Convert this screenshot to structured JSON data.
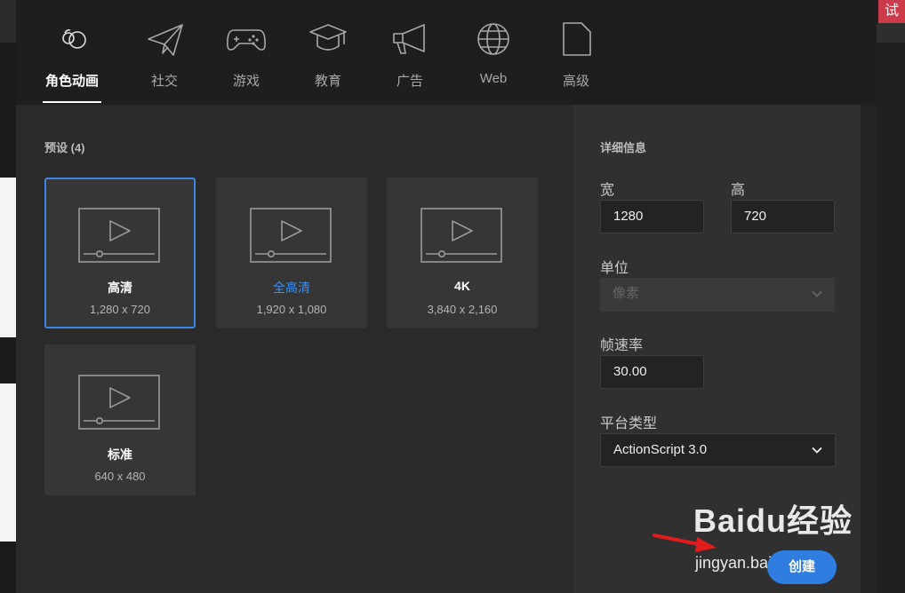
{
  "corner_badge": "试",
  "tabs": [
    {
      "label": "角色动画",
      "icon": "character-animation-icon",
      "active": true
    },
    {
      "label": "社交",
      "icon": "paper-plane-icon"
    },
    {
      "label": "游戏",
      "icon": "gamepad-icon"
    },
    {
      "label": "教育",
      "icon": "graduation-cap-icon"
    },
    {
      "label": "广告",
      "icon": "megaphone-icon"
    },
    {
      "label": "Web",
      "icon": "globe-icon"
    },
    {
      "label": "高级",
      "icon": "document-icon"
    }
  ],
  "presets": {
    "title": "预设 (4)",
    "items": [
      {
        "name": "高清",
        "size": "1,280 x 720",
        "selected": true
      },
      {
        "name": "全高清",
        "size": "1,920 x 1,080"
      },
      {
        "name": "4K",
        "size": "3,840 x 2,160"
      },
      {
        "name": "标准",
        "size": "640 x 480"
      }
    ]
  },
  "details": {
    "title": "详细信息",
    "width_label": "宽",
    "width_value": "1280",
    "height_label": "高",
    "height_value": "720",
    "unit_label": "单位",
    "unit_value": "像素",
    "fps_label": "帧速率",
    "fps_value": "30.00",
    "platform_label": "平台类型",
    "platform_value": "ActionScript 3.0"
  },
  "create_label": "创建",
  "watermark": {
    "brand": "Baidu经验",
    "url": "jingyan.baidu.com"
  },
  "colors": {
    "accent": "#2f7de0",
    "selection": "#3b86e6",
    "highlight_text": "#3b8ff0"
  }
}
